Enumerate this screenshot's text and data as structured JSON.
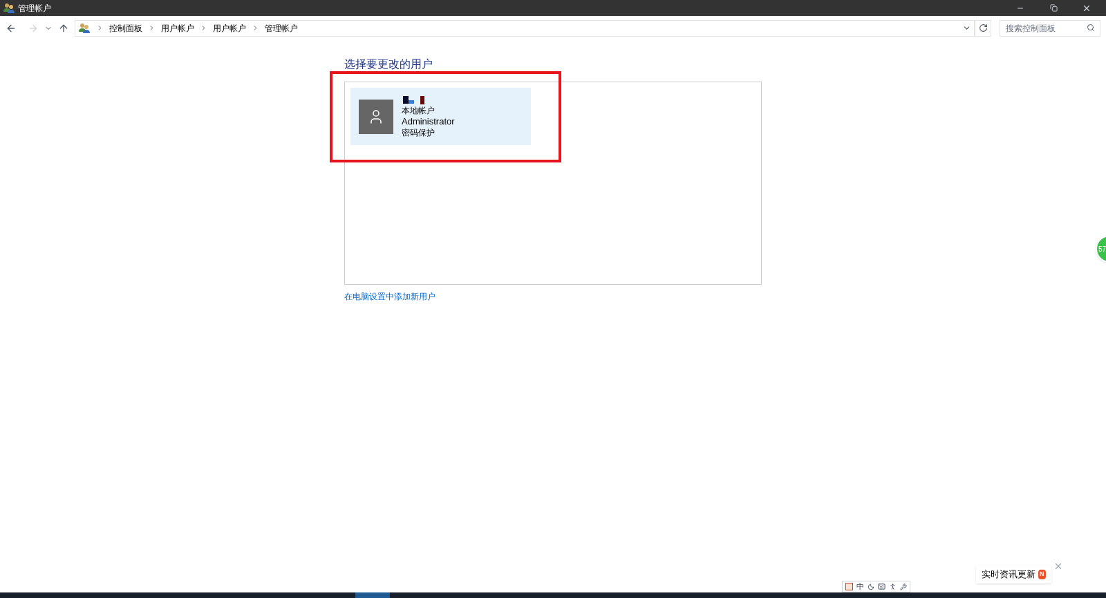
{
  "window": {
    "title": "管理帐户"
  },
  "address_bar": {
    "breadcrumbs": [
      "控制面板",
      "用户帐户",
      "用户帐户",
      "管理帐户"
    ]
  },
  "search": {
    "placeholder": "搜索控制面板"
  },
  "heading": "选择要更改的用户",
  "accounts": [
    {
      "type": "本地帐户",
      "group": "Administrator",
      "protection": "密码保护",
      "selected": true,
      "highlighted": true
    }
  ],
  "add_user_link": "在电脑设置中添加新用户",
  "floating_ball": {
    "text": "57"
  },
  "ime_toolbar": {
    "mode": "中"
  },
  "notification": {
    "text": "实时资讯更新",
    "badge": "N"
  }
}
